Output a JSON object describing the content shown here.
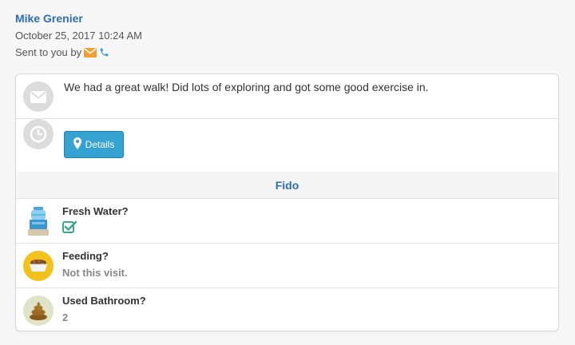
{
  "header": {
    "sender_name": "Mike Grenier",
    "timestamp": "October 25, 2017 10:24 AM",
    "sent_by_label": "Sent to you by"
  },
  "icons": {
    "sent_via": [
      "envelope-icon",
      "phone-icon"
    ],
    "message": "envelope-icon",
    "time": "clock-icon",
    "details": "map-marker-icon"
  },
  "message": {
    "text": "We had a great walk! Did lots of exploring and got some good exercise in."
  },
  "details_button": {
    "label": "Details"
  },
  "pet": {
    "name": "Fido",
    "items": [
      {
        "label": "Fresh Water?",
        "value": "",
        "status": "checked",
        "icon": "water-cooler-icon"
      },
      {
        "label": "Feeding?",
        "value": "Not this visit.",
        "icon": "food-bowl-icon"
      },
      {
        "label": "Used Bathroom?",
        "value": "2",
        "icon": "poop-icon"
      }
    ]
  },
  "colors": {
    "link_blue": "#2d6db5",
    "button_blue": "#34a3d1",
    "envelope_orange": "#f0a030",
    "check_green": "#3aa88a"
  }
}
